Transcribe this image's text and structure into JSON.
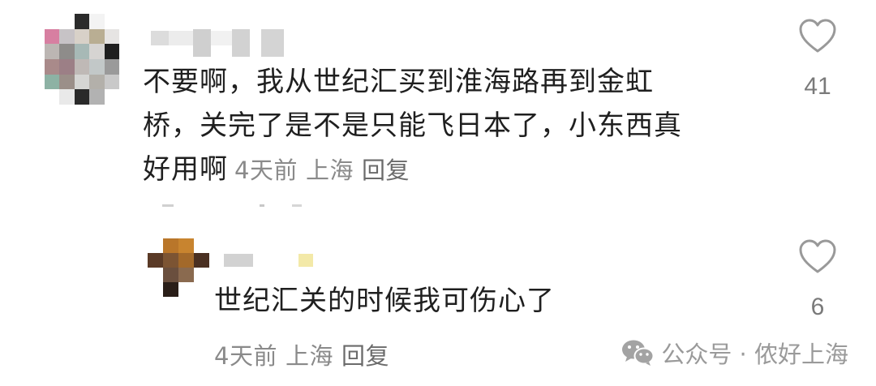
{
  "comments": [
    {
      "text": "不要啊，我从世纪汇买到淮海路再到金虹\n桥，关完了是不是只能飞日本了，小东西真\n好用啊",
      "time": "4天前",
      "location": "上海",
      "reply_label": "回复",
      "likes": "41"
    }
  ],
  "reply": {
    "text": "世纪汇关的时候我可伤心了",
    "time": "4天前",
    "location": "上海",
    "reply_label": "回复",
    "likes": "6"
  },
  "watermark": {
    "text": "公众号 · 侬好上海",
    "icon": "wechat-icon"
  },
  "colors": {
    "text": "#1f1f1f",
    "meta": "#8a8a8a",
    "icon_outline": "#999999"
  }
}
